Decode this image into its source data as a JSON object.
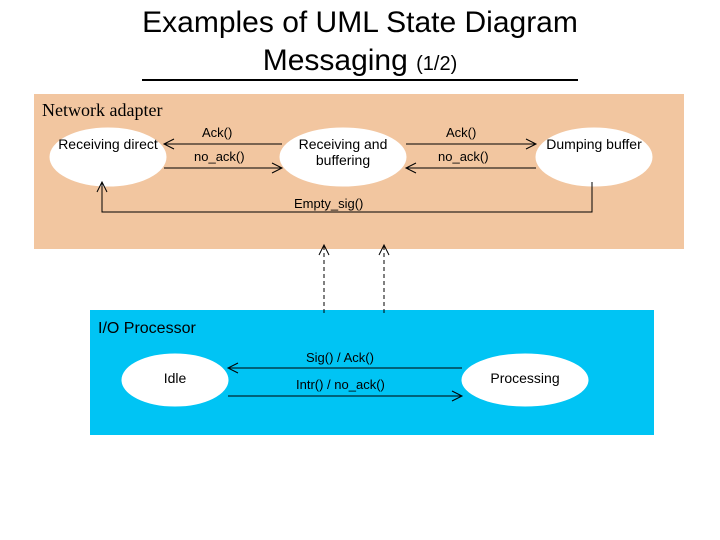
{
  "title_line1": "Examples of UML State Diagram",
  "title_line2": "Messaging",
  "title_page": "(1/2)",
  "network_adapter": {
    "title": "Network adapter",
    "states": {
      "receiving_direct": "Receiving direct",
      "receiving_buffering": "Receiving and buffering",
      "dumping_buffer": "Dumping buffer"
    },
    "transitions": {
      "ack1": "Ack()",
      "no_ack1": "no_ack()",
      "ack2": "Ack()",
      "no_ack2": "no_ack()",
      "empty_sig": "Empty_sig()"
    }
  },
  "io_processor": {
    "title": "I/O Processor",
    "states": {
      "idle": "Idle",
      "processing": "Processing"
    },
    "transitions": {
      "sig_ack": "Sig() / Ack()",
      "intr_noack": "Intr() / no_ack()"
    }
  }
}
